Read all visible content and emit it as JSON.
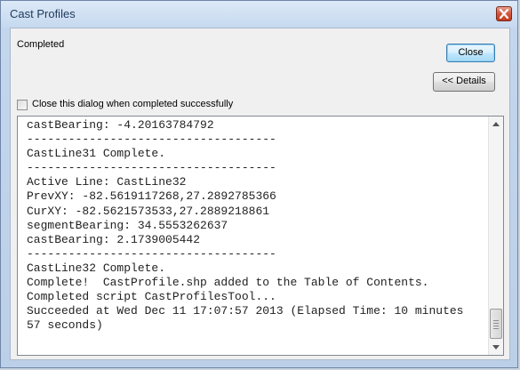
{
  "window": {
    "title": "Cast Profiles"
  },
  "dialog": {
    "status": "Completed",
    "close_button": "Close",
    "details_button": "<< Details",
    "checkbox_label": "Close this dialog when completed successfully",
    "checkbox_checked": false
  },
  "log": {
    "lines": [
      "castBearing: -4.20163784792",
      "------------------------------------",
      "CastLine31 Complete.",
      "------------------------------------",
      "Active Line: CastLine32",
      "PrevXY: -82.5619117268,27.2892785366",
      "CurXY: -82.5621573533,27.2889218861",
      "segmentBearing: 34.5553262637",
      "castBearing: 2.1739005442",
      "------------------------------------",
      "CastLine32 Complete.",
      "Complete!  CastProfile.shp added to the Table of Contents.",
      "Completed script CastProfilesTool...",
      "Succeeded at Wed Dec 11 17:07:57 2013 (Elapsed Time: 10 minutes",
      "57 seconds)"
    ]
  },
  "icons": {
    "window_close": "close-x-icon",
    "scroll_up": "scroll-up-arrow-icon",
    "scroll_down": "scroll-down-arrow-icon",
    "scroll_grip": "scroll-grip-icon"
  },
  "colors": {
    "close_button_accent": "#3c7fb1",
    "window_close_red": "#c23a1f",
    "title_text": "#1e395b"
  }
}
